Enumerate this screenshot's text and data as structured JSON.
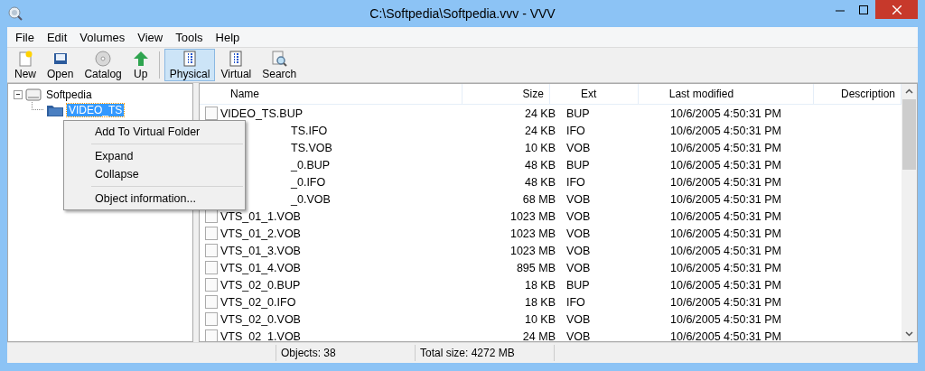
{
  "window": {
    "title": "C:\\Softpedia\\Softpedia.vvv - VVV"
  },
  "menu": [
    "File",
    "Edit",
    "Volumes",
    "View",
    "Tools",
    "Help"
  ],
  "toolbar": [
    {
      "label": "New",
      "kind": "new",
      "selected": false
    },
    {
      "label": "Open",
      "kind": "open",
      "selected": false
    },
    {
      "label": "Catalog",
      "kind": "catalog",
      "selected": false
    },
    {
      "label": "Up",
      "kind": "up",
      "selected": false
    },
    {
      "label": "Physical",
      "kind": "grid",
      "selected": true
    },
    {
      "label": "Virtual",
      "kind": "grid",
      "selected": false
    },
    {
      "label": "Search",
      "kind": "search",
      "selected": false
    }
  ],
  "tree": {
    "label": "Softpedia",
    "expanded": true,
    "children": [
      {
        "label": "VIDEO_TS",
        "selected": true
      }
    ]
  },
  "context_menu": [
    {
      "label": "Add To Virtual Folder",
      "kind": "item"
    },
    {
      "kind": "separator"
    },
    {
      "label": "Expand",
      "kind": "item"
    },
    {
      "label": "Collapse",
      "kind": "item"
    },
    {
      "kind": "separator"
    },
    {
      "label": "Object information...",
      "kind": "item"
    }
  ],
  "table": {
    "columns": [
      "Name",
      "Size",
      "Ext",
      "Last modified",
      "Description"
    ],
    "rows": [
      {
        "name": "VIDEO_TS.BUP",
        "size": "24 KB",
        "ext": "BUP",
        "modified": "10/6/2005 4:50:31 PM",
        "kind": "file"
      },
      {
        "name": "TS.IFO",
        "size": "24 KB",
        "ext": "IFO",
        "modified": "10/6/2005 4:50:31 PM",
        "kind": "partial"
      },
      {
        "name": "TS.VOB",
        "size": "10 KB",
        "ext": "VOB",
        "modified": "10/6/2005 4:50:31 PM",
        "kind": "partial"
      },
      {
        "name": "_0.BUP",
        "size": "48 KB",
        "ext": "BUP",
        "modified": "10/6/2005 4:50:31 PM",
        "kind": "partial"
      },
      {
        "name": "_0.IFO",
        "size": "48 KB",
        "ext": "IFO",
        "modified": "10/6/2005 4:50:31 PM",
        "kind": "partial"
      },
      {
        "name": "_0.VOB",
        "size": "68 MB",
        "ext": "VOB",
        "modified": "10/6/2005 4:50:31 PM",
        "kind": "partial"
      },
      {
        "name": "VTS_01_1.VOB",
        "size": "1023 MB",
        "ext": "VOB",
        "modified": "10/6/2005 4:50:31 PM",
        "kind": "file"
      },
      {
        "name": "VTS_01_2.VOB",
        "size": "1023 MB",
        "ext": "VOB",
        "modified": "10/6/2005 4:50:31 PM",
        "kind": "file"
      },
      {
        "name": "VTS_01_3.VOB",
        "size": "1023 MB",
        "ext": "VOB",
        "modified": "10/6/2005 4:50:31 PM",
        "kind": "file"
      },
      {
        "name": "VTS_01_4.VOB",
        "size": "895 MB",
        "ext": "VOB",
        "modified": "10/6/2005 4:50:31 PM",
        "kind": "file"
      },
      {
        "name": "VTS_02_0.BUP",
        "size": "18 KB",
        "ext": "BUP",
        "modified": "10/6/2005 4:50:31 PM",
        "kind": "file"
      },
      {
        "name": "VTS_02_0.IFO",
        "size": "18 KB",
        "ext": "IFO",
        "modified": "10/6/2005 4:50:31 PM",
        "kind": "file"
      },
      {
        "name": "VTS_02_0.VOB",
        "size": "10 KB",
        "ext": "VOB",
        "modified": "10/6/2005 4:50:31 PM",
        "kind": "file"
      },
      {
        "name": "VTS_02_1.VOB",
        "size": "24 MB",
        "ext": "VOB",
        "modified": "10/6/2005 4:50:31 PM",
        "kind": "file"
      }
    ]
  },
  "status_bar": [
    "Objects: 38",
    "Total size: 4272 MB"
  ]
}
